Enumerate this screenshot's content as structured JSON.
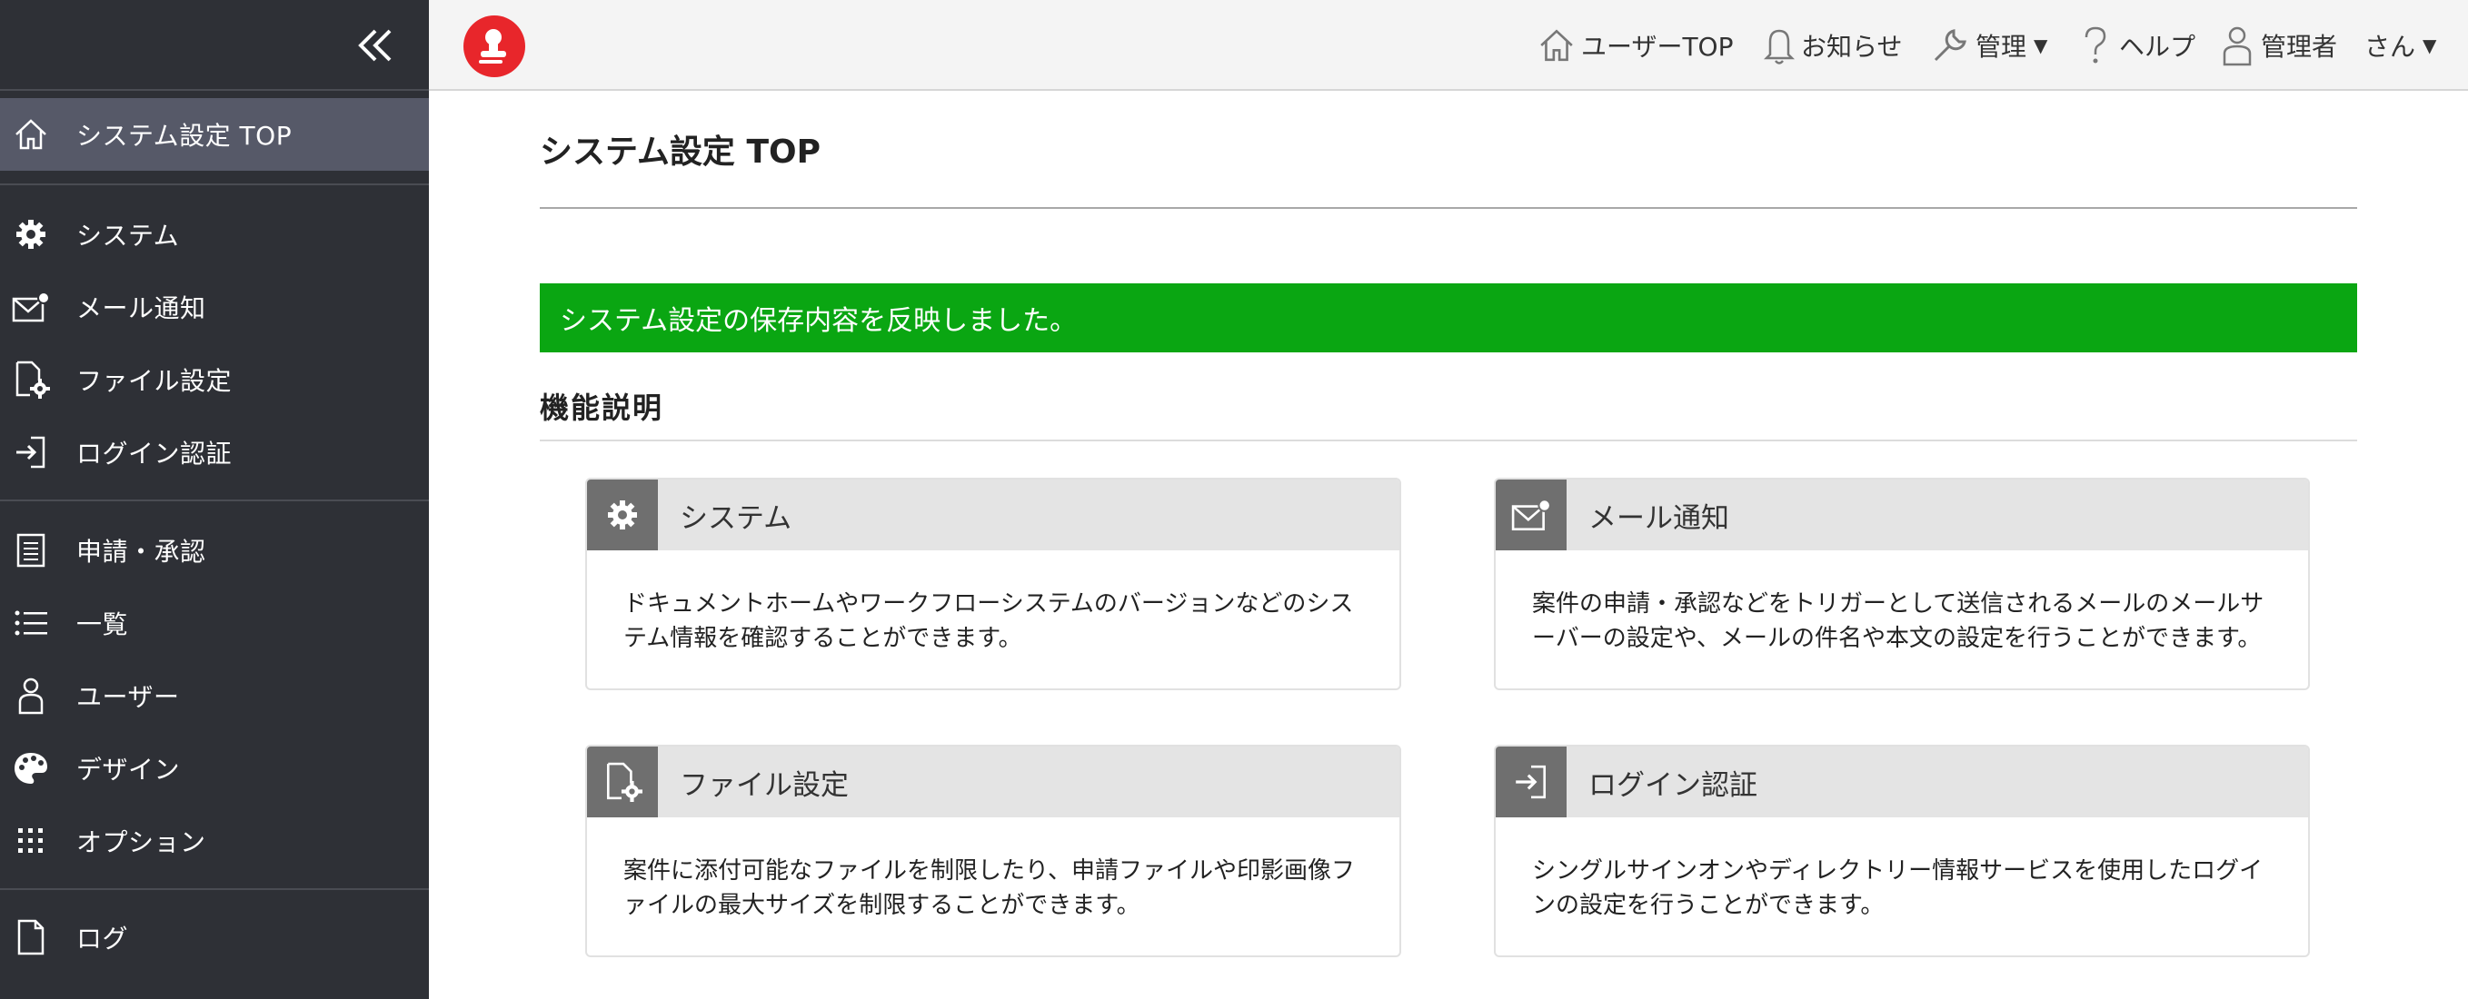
{
  "sidebar": {
    "items": [
      {
        "label": "システム設定 TOP",
        "icon": "home-icon"
      },
      {
        "label": "システム",
        "icon": "gear-icon"
      },
      {
        "label": "メール通知",
        "icon": "mail-notification-icon"
      },
      {
        "label": "ファイル設定",
        "icon": "file-settings-icon"
      },
      {
        "label": "ログイン認証",
        "icon": "login-icon"
      },
      {
        "label": "申請・承認",
        "icon": "document-list-icon"
      },
      {
        "label": "一覧",
        "icon": "list-icon"
      },
      {
        "label": "ユーザー",
        "icon": "user-icon"
      },
      {
        "label": "デザイン",
        "icon": "palette-icon"
      },
      {
        "label": "オプション",
        "icon": "grid-icon"
      },
      {
        "label": "ログ",
        "icon": "file-icon"
      }
    ],
    "active_index": 0
  },
  "header": {
    "nav": {
      "user_top": "ユーザーTOP",
      "notices": "お知らせ",
      "admin": "管理",
      "help": "ヘルプ",
      "user_name": "管理者",
      "user_suffix": "さん"
    }
  },
  "main": {
    "title": "システム設定 TOP",
    "banner": "システム設定の保存内容を反映しました。",
    "section_title": "機能説明",
    "cards": [
      {
        "title": "システム",
        "icon": "gear-icon",
        "description": "ドキュメントホームやワークフローシステムのバージョンなどのシステム情報を確認することができます。"
      },
      {
        "title": "メール通知",
        "icon": "mail-notification-icon",
        "description": "案件の申請・承認などをトリガーとして送信されるメールのメールサーバーの設定や、メールの件名や本文の設定を行うことができます。"
      },
      {
        "title": "ファイル設定",
        "icon": "file-settings-icon",
        "description": "案件に添付可能なファイルを制限したり、申請ファイルや印影画像ファイルの最大サイズを制限することができます。"
      },
      {
        "title": "ログイン認証",
        "icon": "login-icon",
        "description": "シングルサインオンやディレクトリー情報サービスを使用したログインの設定を行うことができます。"
      }
    ]
  },
  "colors": {
    "sidebar_bg": "#2e3036",
    "sidebar_active": "#565968",
    "banner_success": "#0aa612",
    "logo_red": "#e8262b"
  }
}
